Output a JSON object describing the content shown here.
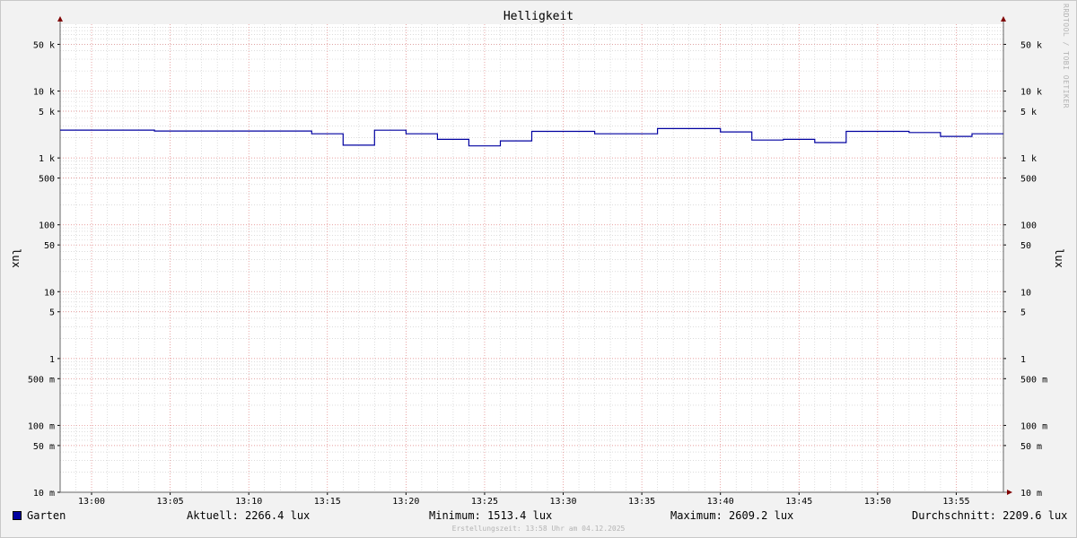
{
  "chart_data": {
    "type": "line",
    "title": "Helligkeit",
    "ylabel": "lux",
    "yscale": "log",
    "ylim": [
      0.01,
      100000
    ],
    "xlim": [
      "12:58",
      "13:58"
    ],
    "grid": true,
    "y_ticks": [
      {
        "value": 50000,
        "label": "50 k"
      },
      {
        "value": 10000,
        "label": "10 k"
      },
      {
        "value": 5000,
        "label": "5 k"
      },
      {
        "value": 1000,
        "label": "1 k"
      },
      {
        "value": 500,
        "label": "500"
      },
      {
        "value": 100,
        "label": "100"
      },
      {
        "value": 50,
        "label": "50"
      },
      {
        "value": 10,
        "label": "10"
      },
      {
        "value": 5,
        "label": "5"
      },
      {
        "value": 1,
        "label": "1"
      },
      {
        "value": 0.5,
        "label": "500 m"
      },
      {
        "value": 0.1,
        "label": "100 m"
      },
      {
        "value": 0.05,
        "label": "50 m"
      },
      {
        "value": 0.01,
        "label": "10 m"
      }
    ],
    "x_ticks": [
      "13:00",
      "13:05",
      "13:10",
      "13:15",
      "13:20",
      "13:25",
      "13:30",
      "13:35",
      "13:40",
      "13:45",
      "13:50",
      "13:55"
    ],
    "series": [
      {
        "name": "Garten",
        "color": "#0000a0",
        "step": true,
        "points": [
          [
            "12:58",
            2609
          ],
          [
            "13:04",
            2530
          ],
          [
            "13:14",
            2300
          ],
          [
            "13:16",
            1550
          ],
          [
            "13:18",
            2600
          ],
          [
            "13:20",
            2300
          ],
          [
            "13:22",
            1900
          ],
          [
            "13:24",
            1513
          ],
          [
            "13:26",
            1800
          ],
          [
            "13:28",
            2500
          ],
          [
            "13:32",
            2300
          ],
          [
            "13:36",
            2750
          ],
          [
            "13:40",
            2450
          ],
          [
            "13:42",
            1850
          ],
          [
            "13:44",
            1900
          ],
          [
            "13:46",
            1700
          ],
          [
            "13:48",
            2500
          ],
          [
            "13:52",
            2400
          ],
          [
            "13:54",
            2100
          ],
          [
            "13:56",
            2300
          ],
          [
            "13:58",
            2266
          ]
        ]
      }
    ]
  },
  "legend": {
    "series_name": "Garten",
    "current": "Aktuell: 2266.4 lux",
    "minimum": "Minimum: 1513.4 lux",
    "maximum": "Maximum: 2609.2 lux",
    "average": "Durchschnitt: 2209.6 lux"
  },
  "watermark": "RRDTOOL / TOBI OETIKER",
  "footer": "Erstellungszeit: 13:58 Uhr am 04.12.2025",
  "colors": {
    "background": "#f2f2f2",
    "canvas": "#ffffff",
    "major_grid": "#e08080",
    "minor_grid": "#c8c8c8",
    "series": "#0000a0",
    "arrow": "#800000"
  }
}
